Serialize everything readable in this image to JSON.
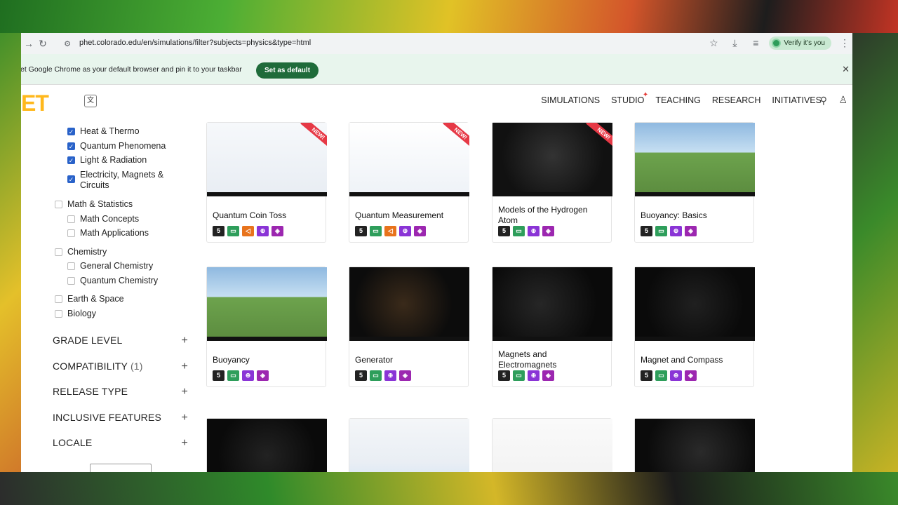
{
  "browser": {
    "url": "phet.colorado.edu/en/simulations/filter?subjects=physics&type=html",
    "verify_label": "Verify it's you"
  },
  "infobar": {
    "text": "et Google Chrome as your default browser and pin it to your taskbar",
    "button": "Set as default"
  },
  "site": {
    "logo": "ET",
    "nav": [
      "SIMULATIONS",
      "STUDIO",
      "TEACHING",
      "RESEARCH",
      "INITIATIVES"
    ]
  },
  "sidebar": {
    "physics_items": [
      {
        "label": "Heat & Thermo",
        "checked": true
      },
      {
        "label": "Quantum Phenomena",
        "checked": true
      },
      {
        "label": "Light & Radiation",
        "checked": true
      },
      {
        "label": "Electricity, Magnets & Circuits",
        "checked": true
      }
    ],
    "math": {
      "label": "Math & Statistics",
      "items": [
        "Math Concepts",
        "Math Applications"
      ]
    },
    "chemistry": {
      "label": "Chemistry",
      "items": [
        "General Chemistry",
        "Quantum Chemistry"
      ]
    },
    "earth": "Earth & Space",
    "biology": "Biology",
    "facets": [
      {
        "label": "GRADE LEVEL",
        "count": ""
      },
      {
        "label": "COMPATIBILITY",
        "count": "(1)"
      },
      {
        "label": "RELEASE TYPE",
        "count": ""
      },
      {
        "label": "INCLUSIVE FEATURES",
        "count": ""
      },
      {
        "label": "LOCALE",
        "count": ""
      }
    ]
  },
  "cards": [
    {
      "title": "Quantum Coin Toss",
      "new": true,
      "badges": [
        "html",
        "green",
        "orange",
        "purple",
        "magenta"
      ]
    },
    {
      "title": "Quantum Measurement",
      "new": true,
      "badges": [
        "html",
        "green",
        "orange",
        "purple",
        "magenta"
      ]
    },
    {
      "title": "Models of the Hydrogen Atom",
      "new": true,
      "badges": [
        "html",
        "green",
        "purple",
        "magenta"
      ]
    },
    {
      "title": "Buoyancy: Basics",
      "new": false,
      "badges": [
        "html",
        "green",
        "purple",
        "magenta"
      ]
    },
    {
      "title": "Buoyancy",
      "new": false,
      "badges": [
        "html",
        "green",
        "purple",
        "magenta"
      ]
    },
    {
      "title": "Generator",
      "new": false,
      "badges": [
        "html",
        "green",
        "purple",
        "magenta"
      ]
    },
    {
      "title": "Magnets and Electromagnets",
      "new": false,
      "badges": [
        "html",
        "green",
        "purple",
        "magenta"
      ]
    },
    {
      "title": "Magnet and Compass",
      "new": false,
      "badges": [
        "html",
        "green",
        "purple",
        "magenta"
      ]
    },
    {
      "title": "",
      "new": false,
      "badges": []
    },
    {
      "title": "",
      "new": false,
      "badges": []
    },
    {
      "title": "",
      "new": false,
      "badges": []
    },
    {
      "title": "",
      "new": false,
      "badges": []
    }
  ],
  "new_label": "NEW!",
  "badge_glyphs": {
    "html": "5",
    "green": "▭",
    "orange": "◁",
    "purple": "⊕",
    "magenta": "◈"
  }
}
